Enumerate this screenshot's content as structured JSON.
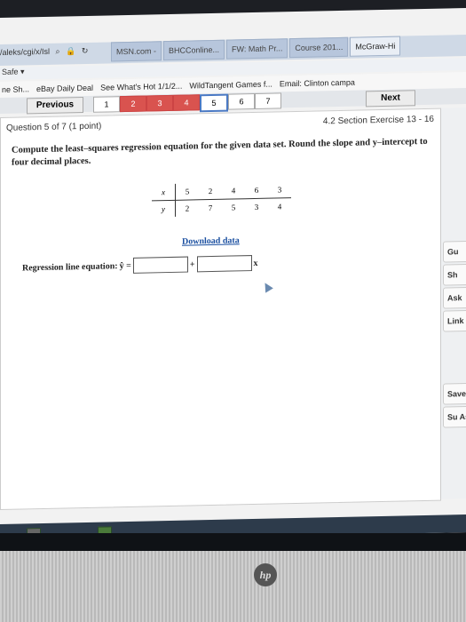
{
  "browser": {
    "address_text": "/aleks/cgi/x/Isl",
    "address_icons": [
      "search-icon",
      "lock-icon",
      "refresh-icon"
    ],
    "tabs": [
      {
        "label": "MSN.com -"
      },
      {
        "label": "BHCConline..."
      },
      {
        "label": "FW: Math Pr..."
      },
      {
        "label": "Course 201..."
      },
      {
        "label": "McGraw-Hi"
      }
    ],
    "menu_label": "Safe",
    "favorites": [
      {
        "label": "ne Sh..."
      },
      {
        "label": "eBay Daily Deal"
      },
      {
        "label": "See What's Hot 1/1/2..."
      },
      {
        "label": "WildTangent Games f..."
      },
      {
        "label": "Email: Clinton campa"
      }
    ]
  },
  "nav": {
    "previous_label": "Previous",
    "next_label": "Next",
    "pages": [
      "1",
      "2",
      "3",
      "4",
      "5",
      "6",
      "7"
    ],
    "current_page": "5"
  },
  "question": {
    "header_left": "Question 5 of 7 (1 point)",
    "header_right": "4.2 Section Exercise 13 - 16",
    "text": "Compute the least–squares regression equation for the given data set. Round the slope and y–intercept to four decimal places.",
    "table": {
      "x_label": "x",
      "y_label": "y",
      "x_values": [
        "5",
        "2",
        "4",
        "6",
        "3"
      ],
      "y_values": [
        "2",
        "7",
        "5",
        "3",
        "4"
      ]
    },
    "download_link": "Download data",
    "equation_label": "Regression line equation:",
    "yhat_eq": "ŷ =",
    "plus": "+",
    "x_suffix": "x",
    "intercept_value": "",
    "slope_value": ""
  },
  "sidebar": {
    "buttons": [
      {
        "label": "Gu"
      },
      {
        "label": "Sh"
      },
      {
        "label": "Ask"
      },
      {
        "label": "Link"
      },
      {
        "label": "Save"
      },
      {
        "label": "Su Assi"
      }
    ]
  },
  "brand": {
    "logo_text": "hp"
  }
}
